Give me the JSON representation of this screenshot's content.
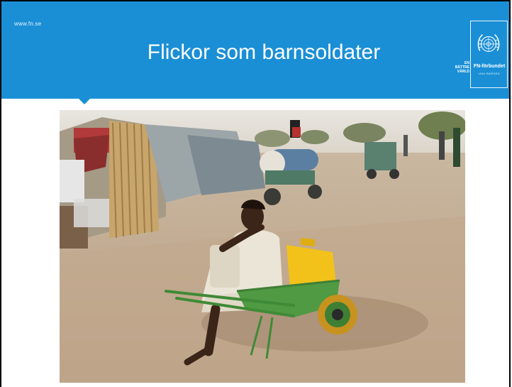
{
  "slide": {
    "website": "www.fn.se",
    "title": "Flickor som barnsoldater"
  },
  "logo": {
    "tagline_lines": [
      "EN",
      "BÄTTRE",
      "VÄRLD"
    ],
    "name": "FN-förbundet",
    "subtitle": "UNA SWEDEN",
    "icon": "un-emblem-icon"
  },
  "photo": {
    "icon": "photo-girl-wheelbarrow"
  },
  "colors": {
    "header_blue": "#1a8fd6",
    "text_white": "#ffffff"
  }
}
